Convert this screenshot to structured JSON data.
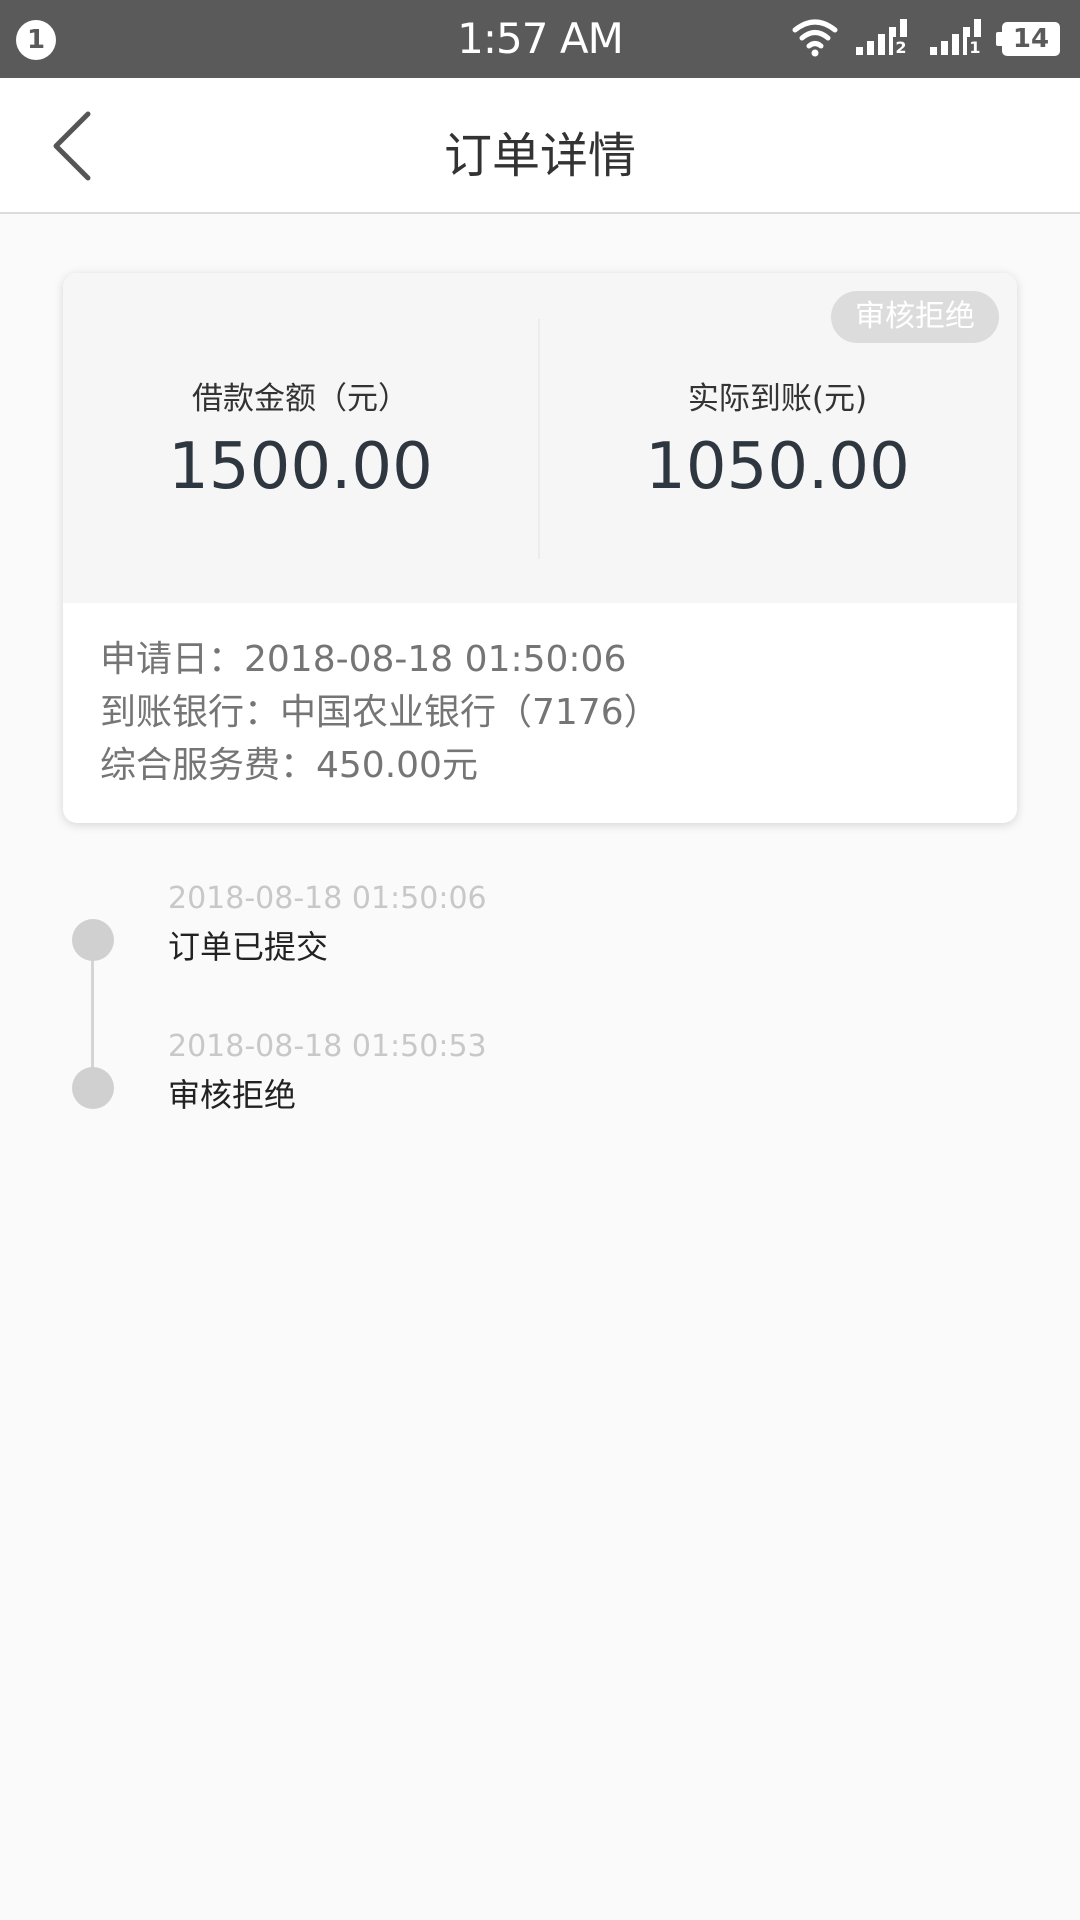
{
  "status_bar": {
    "notification_count": "1",
    "time": "1:57 AM",
    "battery": "14",
    "icons": [
      "wifi-icon",
      "signal-sim2-icon",
      "signal-sim1-icon",
      "battery-icon"
    ]
  },
  "nav": {
    "title": "订单详情",
    "back_icon": "back-chevron-icon"
  },
  "order": {
    "status_badge": "审核拒绝",
    "loan_amount_label": "借款金额（元）",
    "loan_amount_value": "1500.00",
    "received_label": "实际到账(元)",
    "received_value": "1050.00",
    "apply_date_line": "申请日：2018-08-18 01:50:06",
    "bank_line": "到账银行：中国农业银行（7176）",
    "fee_line": "综合服务费：450.00元"
  },
  "timeline": [
    {
      "time": "2018-08-18 01:50:06",
      "text": "订单已提交"
    },
    {
      "time": "2018-08-18 01:50:53",
      "text": "审核拒绝"
    }
  ],
  "colors": {
    "status_bar_bg": "#5a5a5a",
    "card_top_bg": "#f6f6f6",
    "badge_bg": "#dcdcdc",
    "timeline_dot": "#d0d0d0",
    "amount_text": "#2e3640"
  }
}
